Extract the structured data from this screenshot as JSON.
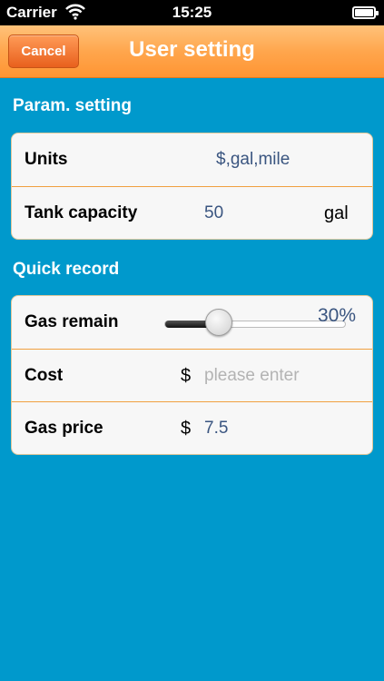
{
  "status_bar": {
    "carrier": "Carrier",
    "time": "15:25"
  },
  "nav": {
    "cancel_label": "Cancel",
    "title": "User setting"
  },
  "param_section": {
    "header": "Param. setting",
    "units": {
      "label": "Units",
      "value": "$,gal,mile"
    },
    "tank": {
      "label": "Tank capacity",
      "value": "50",
      "unit": "gal"
    }
  },
  "quick_section": {
    "header": "Quick record",
    "gas_remain": {
      "label": "Gas remain",
      "value_text": "30%",
      "level": 0.3
    },
    "cost": {
      "label": "Cost",
      "currency": "$",
      "placeholder": "please enter"
    },
    "gas_price": {
      "label": "Gas price",
      "currency": "$",
      "value": "7.5"
    }
  },
  "colors": {
    "background": "#0099cc",
    "nav_orange": "#ffa64d",
    "value_blue": "#3a5580",
    "separator": "#f0a040"
  }
}
